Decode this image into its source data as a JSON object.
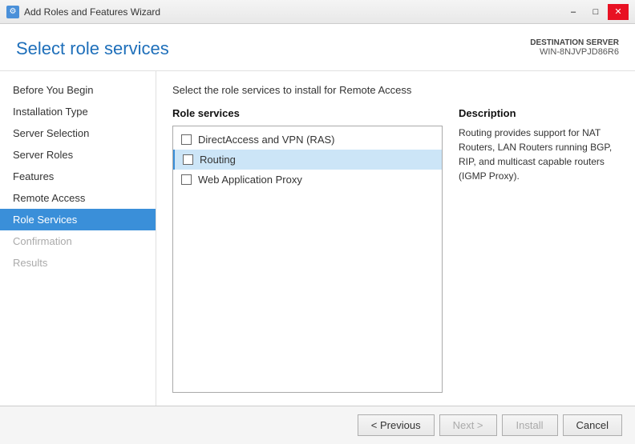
{
  "titlebar": {
    "title": "Add Roles and Features Wizard",
    "icon": "⚙"
  },
  "header": {
    "title": "Select role services",
    "destination_label": "DESTINATION SERVER",
    "destination_value": "WIN-8NJVPJD86R6"
  },
  "instruction": "Select the role services to install for Remote Access",
  "sidebar": {
    "items": [
      {
        "label": "Before You Begin",
        "state": "normal"
      },
      {
        "label": "Installation Type",
        "state": "normal"
      },
      {
        "label": "Server Selection",
        "state": "normal"
      },
      {
        "label": "Server Roles",
        "state": "normal"
      },
      {
        "label": "Features",
        "state": "normal"
      },
      {
        "label": "Remote Access",
        "state": "normal"
      },
      {
        "label": "Role Services",
        "state": "active"
      },
      {
        "label": "Confirmation",
        "state": "disabled"
      },
      {
        "label": "Results",
        "state": "disabled"
      }
    ]
  },
  "role_services": {
    "header": "Role services",
    "items": [
      {
        "label": "DirectAccess and VPN (RAS)",
        "checked": false,
        "selected": false
      },
      {
        "label": "Routing",
        "checked": false,
        "selected": true
      },
      {
        "label": "Web Application Proxy",
        "checked": false,
        "selected": false
      }
    ]
  },
  "description": {
    "header": "Description",
    "text": "Routing provides support for NAT Routers, LAN Routers running BGP, RIP, and multicast capable routers (IGMP Proxy)."
  },
  "footer": {
    "previous_label": "< Previous",
    "next_label": "Next >",
    "install_label": "Install",
    "cancel_label": "Cancel"
  }
}
